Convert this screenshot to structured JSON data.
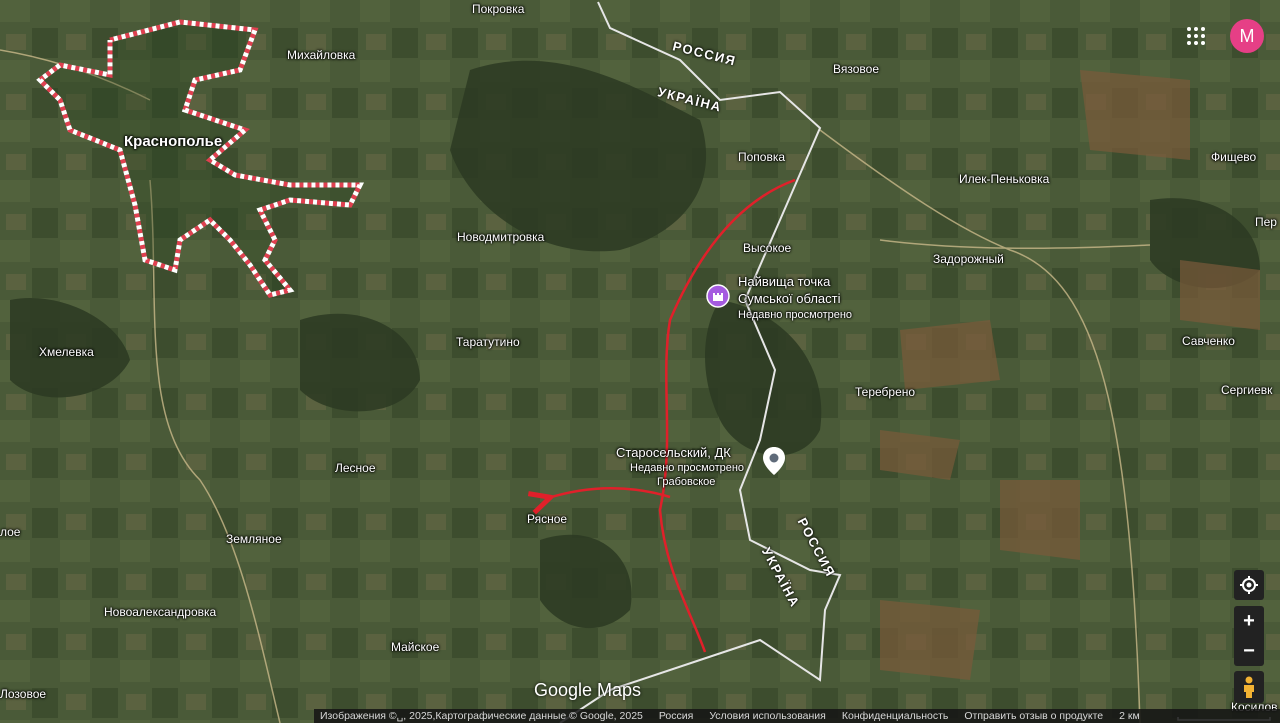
{
  "map": {
    "towns": [
      {
        "name": "Покровка"
      },
      {
        "name": "Михайловка"
      },
      {
        "name": "Краснополье"
      },
      {
        "name": "Вязовое"
      },
      {
        "name": "Поповка"
      },
      {
        "name": "Фищево"
      },
      {
        "name": "Илек-Пеньковка"
      },
      {
        "name": "Пер"
      },
      {
        "name": "Высокое"
      },
      {
        "name": "Новодмитровка"
      },
      {
        "name": "Задорожный"
      },
      {
        "name": "Таратутино"
      },
      {
        "name": "Хмелевка"
      },
      {
        "name": "Савченко"
      },
      {
        "name": "Теребрено"
      },
      {
        "name": "Сергиевк"
      },
      {
        "name": "Лесное"
      },
      {
        "name": "Рясное"
      },
      {
        "name": "лое"
      },
      {
        "name": "Земляное"
      },
      {
        "name": "Новоалександровка"
      },
      {
        "name": "Майское"
      },
      {
        "name": "Лозовое"
      },
      {
        "name": "Косилов"
      },
      {
        "name": "Грабовское"
      }
    ],
    "borders": {
      "russia": "РОССИЯ",
      "ukraine": "УКРАЇНА"
    },
    "pois": [
      {
        "title_line1": "Найвища точка",
        "title_line2": "Сумської області",
        "subtitle": "Недавно просмотрено",
        "icon": "castle-icon",
        "color": "#a55be0"
      },
      {
        "title": "Старосельский, ДК",
        "subtitle": "Недавно просмотрено",
        "icon": "map-pin-icon",
        "color": "#ffffff"
      }
    ]
  },
  "logo": "Google Maps",
  "avatar_letter": "M",
  "footer": {
    "imagery": "Изображения ©␣, 2025,Картографические данные © Google, 2025",
    "country": "Россия",
    "terms": "Условия использования",
    "privacy": "Конфиденциальность",
    "feedback": "Отправить отзыв о продукте",
    "scale": "2 км"
  },
  "colors": {
    "red_route": "#e0202a",
    "region_outline": "#e04050",
    "border_line": "#e6e6e6"
  }
}
